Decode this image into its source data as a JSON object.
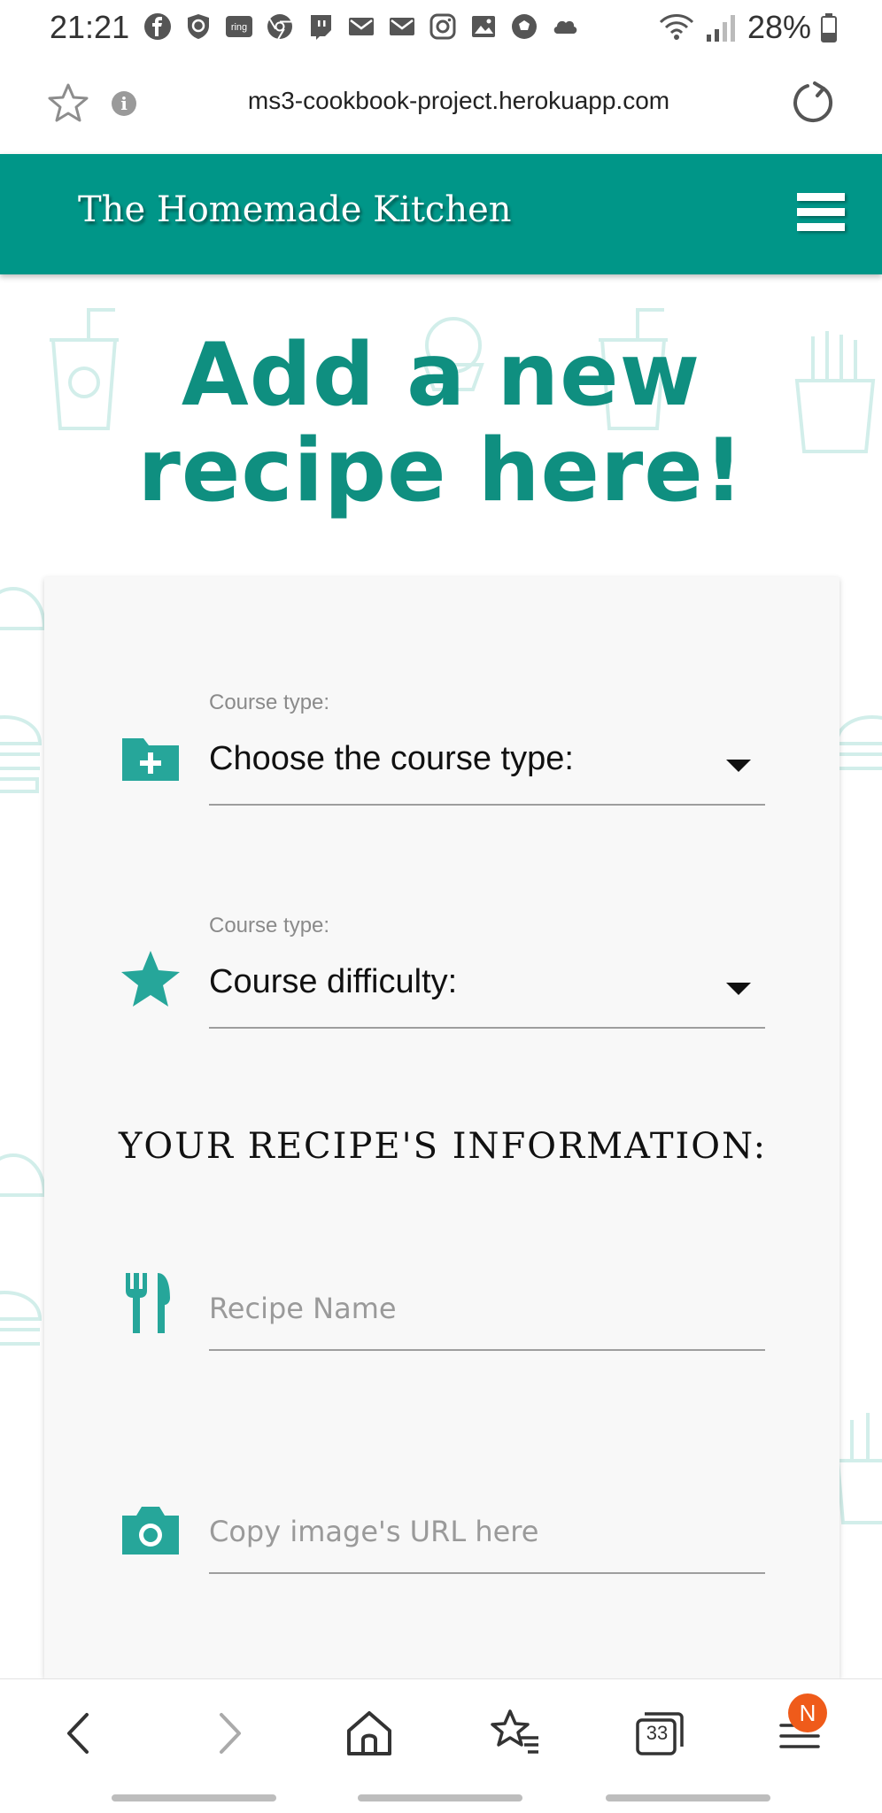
{
  "status_bar": {
    "time": "21:21",
    "notification_icons": [
      "facebook-icon",
      "shield-icon",
      "ring-icon",
      "chrome-icon",
      "twitch-icon",
      "mail-icon",
      "mail-icon",
      "instagram-icon",
      "image-icon",
      "soccer-icon",
      "cloud-icon"
    ],
    "ring_text": "ring",
    "battery": "28%"
  },
  "browser": {
    "url": "ms3-cookbook-project.herokuapp.com",
    "info_glyph": "i"
  },
  "header": {
    "brand": "The Homemade Kitchen"
  },
  "hero": {
    "line1": "Add a new",
    "line2": "recipe here!"
  },
  "form": {
    "course_type": {
      "label": "Course type:",
      "value": "Choose the course type:"
    },
    "difficulty": {
      "label": "Course type:",
      "value": "Course difficulty:"
    },
    "section_title": "YOUR RECIPE'S INFORMATION:",
    "recipe_name": {
      "placeholder": "Recipe Name"
    },
    "image_url": {
      "placeholder": "Copy image's URL here"
    }
  },
  "bottom_nav": {
    "tab_count": "33",
    "notification_badge": "N"
  },
  "colors": {
    "brand_teal": "#009688",
    "heading_teal": "#0f8f80",
    "badge_orange": "#ef5b1a"
  }
}
